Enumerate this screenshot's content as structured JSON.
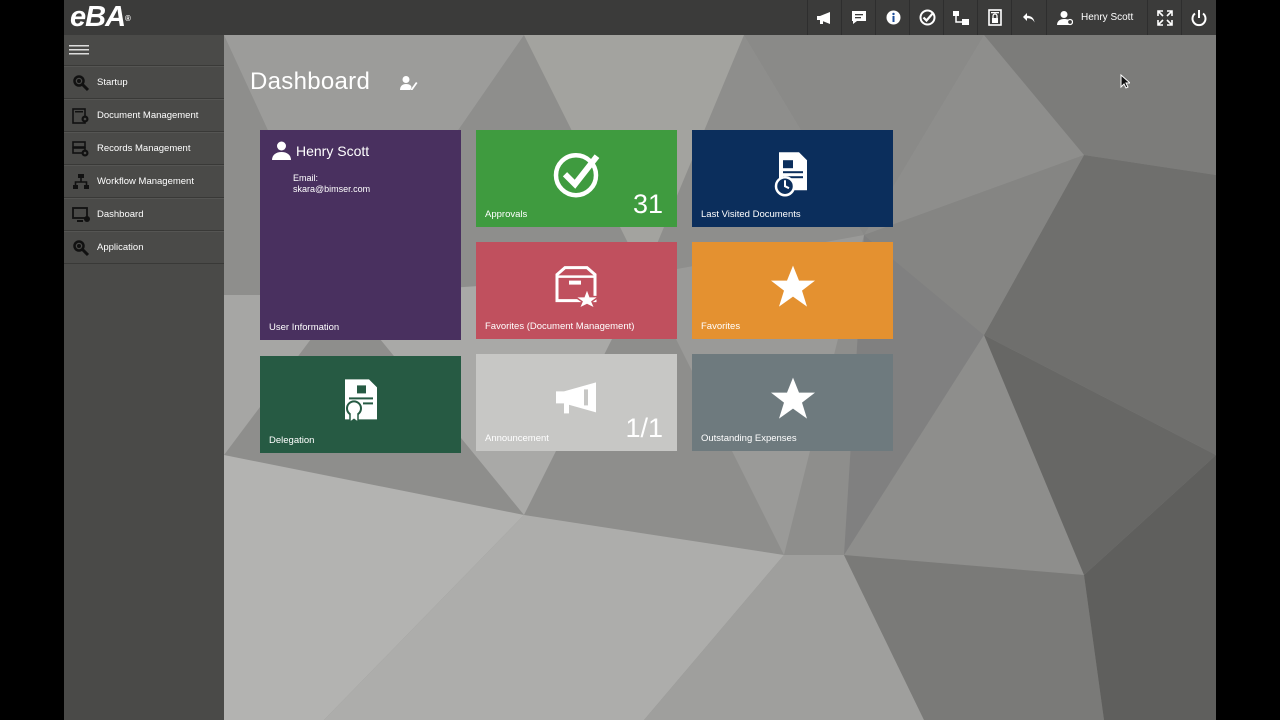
{
  "app": {
    "logo": "eBA",
    "logo_mark": "®"
  },
  "topbar": {
    "icons": [
      "megaphone-icon",
      "message-icon",
      "info-icon",
      "check-icon",
      "org-chart-icon",
      "document-lock-icon",
      "undo-icon"
    ],
    "user_name": "Henry Scott"
  },
  "sidebar": {
    "items": [
      {
        "label": "Startup",
        "icon": "gear-search-icon"
      },
      {
        "label": "Document Management",
        "icon": "document-gear-icon"
      },
      {
        "label": "Records Management",
        "icon": "records-gear-icon"
      },
      {
        "label": "Workflow Management",
        "icon": "workflow-icon"
      },
      {
        "label": "Dashboard",
        "icon": "monitor-icon"
      },
      {
        "label": "Application",
        "icon": "gear-search-icon"
      }
    ]
  },
  "dashboard": {
    "title": "Dashboard",
    "user_tile": {
      "name": "Henry Scott",
      "email_label": "Email:",
      "email": "skara@bimser.com",
      "label": "User Information",
      "color": "#49305f"
    },
    "tiles": [
      {
        "key": "approvals",
        "label": "Approvals",
        "count": "31",
        "icon": "check-circle-icon",
        "color": "#3f9b3f"
      },
      {
        "key": "last-visited",
        "label": "Last Visited Documents",
        "icon": "document-clock-icon",
        "color": "#0b2e5c"
      },
      {
        "key": "favorites-dm",
        "label": "Favorites (Document Management)",
        "icon": "box-star-icon",
        "color": "#c0505e"
      },
      {
        "key": "favorites",
        "label": "Favorites",
        "icon": "star-icon",
        "color": "#e49130"
      },
      {
        "key": "delegation",
        "label": "Delegation",
        "icon": "certificate-icon",
        "color": "#265a43"
      },
      {
        "key": "announcement",
        "label": "Announcement",
        "count": "1/1",
        "icon": "megaphone-icon",
        "color": "#c7c7c5"
      },
      {
        "key": "outstanding-expenses",
        "label": "Outstanding Expenses",
        "icon": "star-icon",
        "color": "#6e7a7e"
      }
    ]
  }
}
